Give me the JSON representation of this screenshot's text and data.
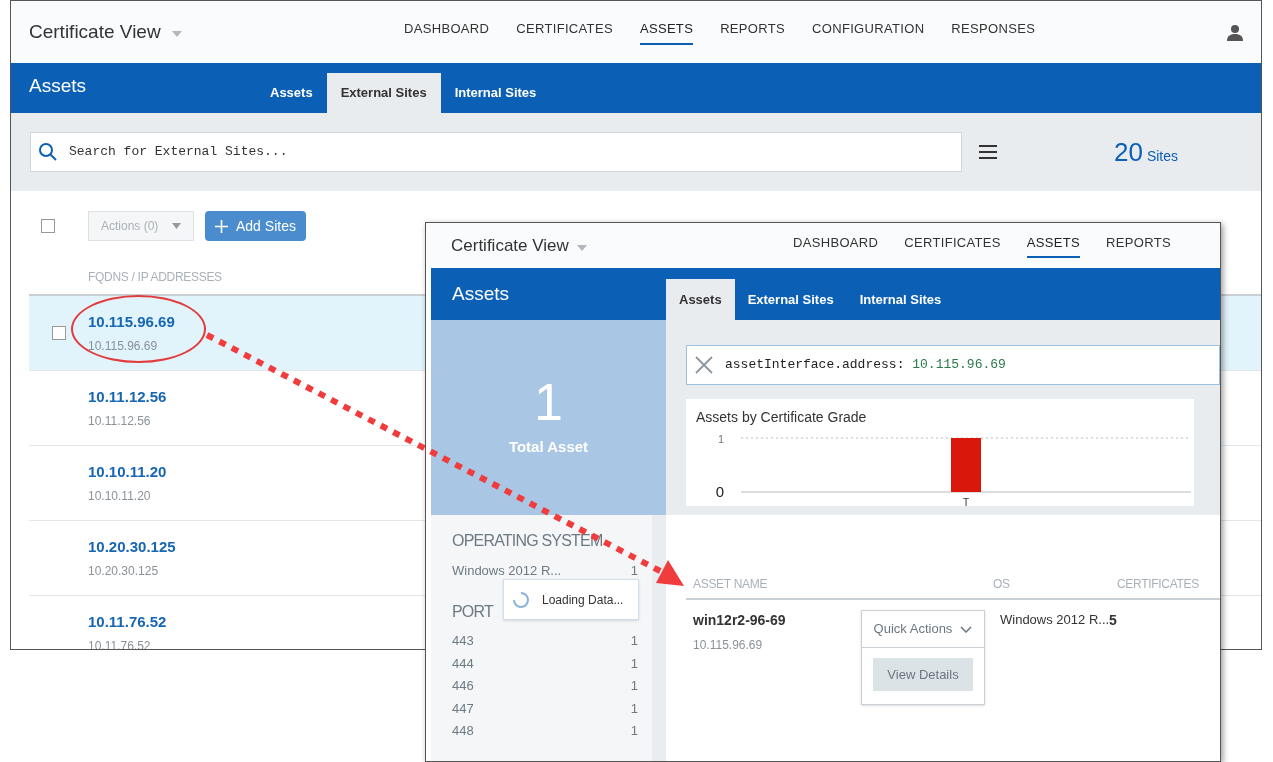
{
  "main_window": {
    "app_title": "Certificate View",
    "nav": [
      {
        "label": "DASHBOARD",
        "selected": false
      },
      {
        "label": "CERTIFICATES",
        "selected": false
      },
      {
        "label": "ASSETS",
        "selected": true
      },
      {
        "label": "REPORTS",
        "selected": false
      },
      {
        "label": "CONFIGURATION",
        "selected": false
      },
      {
        "label": "RESPONSES",
        "selected": false
      }
    ],
    "page_title": "Assets",
    "tabs": [
      {
        "label": "Assets",
        "selected": false
      },
      {
        "label": "External Sites",
        "selected": true
      },
      {
        "label": "Internal Sites",
        "selected": false
      }
    ],
    "search": {
      "placeholder": "Search for External Sites..."
    },
    "site_count": {
      "value": "20",
      "unit": "Sites"
    },
    "toolbar": {
      "select_all_checked": false,
      "actions": {
        "label": "Actions (0)",
        "disabled": true
      },
      "add_button": "Add Sites"
    },
    "column_header": "FQDNS / IP ADDRESSES",
    "rows": [
      {
        "name": "10.115.96.69",
        "address": "10.115.96.69",
        "selected": true
      },
      {
        "name": "10.11.12.56",
        "address": "10.11.12.56",
        "selected": false
      },
      {
        "name": "10.10.11.20",
        "address": "10.10.11.20",
        "selected": false
      },
      {
        "name": "10.20.30.125",
        "address": "10.20.30.125",
        "selected": false
      },
      {
        "name": "10.11.76.52",
        "address": "10.11.76.52",
        "selected": false
      }
    ]
  },
  "detail_window": {
    "app_title": "Certificate View",
    "nav": [
      {
        "label": "DASHBOARD",
        "selected": false
      },
      {
        "label": "CERTIFICATES",
        "selected": false
      },
      {
        "label": "ASSETS",
        "selected": true
      },
      {
        "label": "REPORTS",
        "selected": false
      }
    ],
    "page_title": "Assets",
    "tabs": [
      {
        "label": "Assets",
        "selected": true
      },
      {
        "label": "External Sites",
        "selected": false
      },
      {
        "label": "Internal Sites",
        "selected": false
      }
    ],
    "total": {
      "value": "1",
      "label": "Total Asset"
    },
    "filters": {
      "loading": true,
      "loading_text": "Loading Data...",
      "sections": [
        {
          "title": "OPERATING SYSTEM",
          "items": [
            {
              "label": "Windows 2012 R...",
              "count": "1"
            }
          ]
        },
        {
          "title": "PORT",
          "items": [
            {
              "label": "443",
              "count": "1"
            },
            {
              "label": "444",
              "count": "1"
            },
            {
              "label": "446",
              "count": "1"
            },
            {
              "label": "447",
              "count": "1"
            },
            {
              "label": "448",
              "count": "1"
            }
          ]
        }
      ]
    },
    "filter_query": {
      "key": "assetInterface.address:",
      "value": "10.115.96.69"
    },
    "chart": {
      "title": "Assets by Certificate Grade",
      "chart_data": {
        "type": "bar",
        "categories": [
          "T"
        ],
        "series": [
          {
            "color": "#d9180b",
            "values": [
              1
            ]
          }
        ],
        "ylim": [
          0,
          1
        ],
        "yticks": [
          0,
          1
        ]
      }
    },
    "table": {
      "columns": [
        "ASSET NAME",
        "OS",
        "CERTIFICATES"
      ],
      "rows": [
        {
          "name": "win12r2-96-69",
          "address": "10.115.96.69",
          "os": "Windows 2012 R...",
          "certificates": "5"
        }
      ],
      "quick_actions": {
        "label": "Quick Actions",
        "items": [
          "View Details"
        ]
      }
    }
  }
}
